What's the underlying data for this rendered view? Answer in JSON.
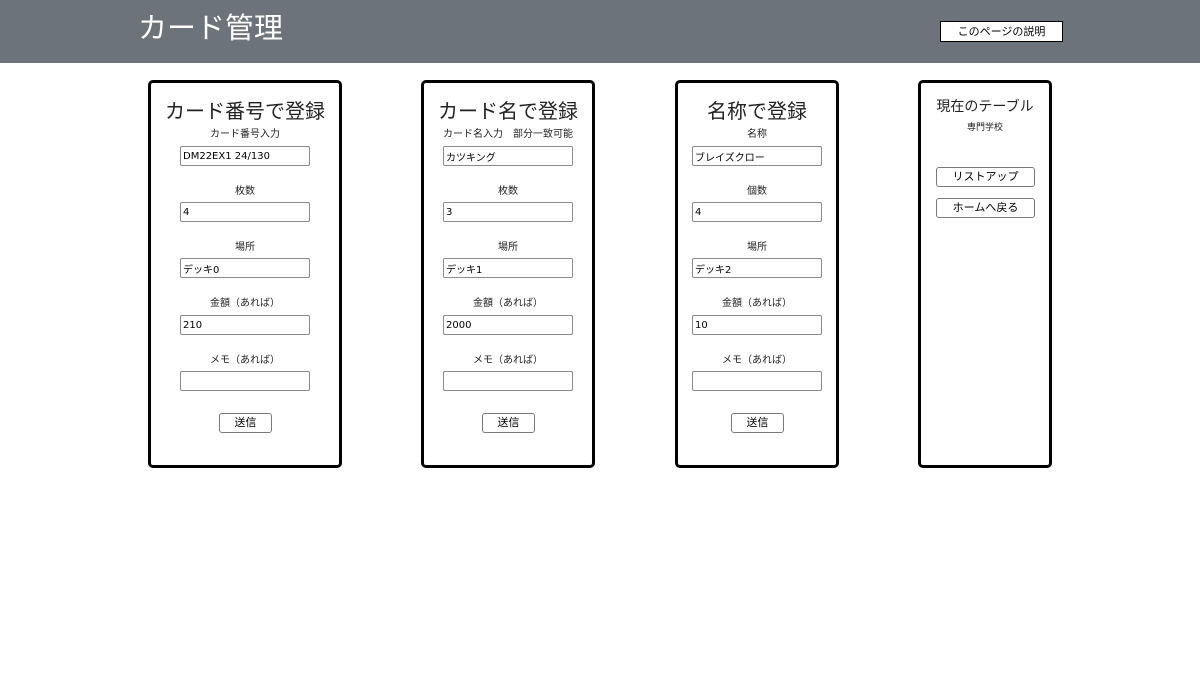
{
  "header": {
    "title": "カード管理",
    "help_label": "このページの説明"
  },
  "panels": [
    {
      "title": "カード番号で登録",
      "fields": [
        {
          "label": "カード番号入力",
          "value": "DM22EX1 24/130"
        },
        {
          "label": "枚数",
          "value": "4"
        },
        {
          "label": "場所",
          "value": "デッキ0"
        },
        {
          "label": "金額（あれば）",
          "value": "210"
        },
        {
          "label": "メモ（あれば）",
          "value": ""
        }
      ],
      "submit_label": "送信"
    },
    {
      "title": "カード名で登録",
      "fields": [
        {
          "label": "カード名入力　部分一致可能",
          "value": "カツキング"
        },
        {
          "label": "枚数",
          "value": "3"
        },
        {
          "label": "場所",
          "value": "デッキ1"
        },
        {
          "label": "金額（あれば）",
          "value": "2000"
        },
        {
          "label": "メモ（あれば）",
          "value": ""
        }
      ],
      "submit_label": "送信"
    },
    {
      "title": "名称で登録",
      "fields": [
        {
          "label": "名称",
          "value": "ブレイズクロー"
        },
        {
          "label": "個数",
          "value": "4"
        },
        {
          "label": "場所",
          "value": "デッキ2"
        },
        {
          "label": "金額（あれば）",
          "value": "10"
        },
        {
          "label": "メモ（あれば）",
          "value": ""
        }
      ],
      "submit_label": "送信"
    }
  ],
  "table_panel": {
    "title": "現在のテーブル",
    "current_table": "専門学校",
    "listup_label": "リストアップ",
    "home_label": "ホームへ戻る"
  }
}
